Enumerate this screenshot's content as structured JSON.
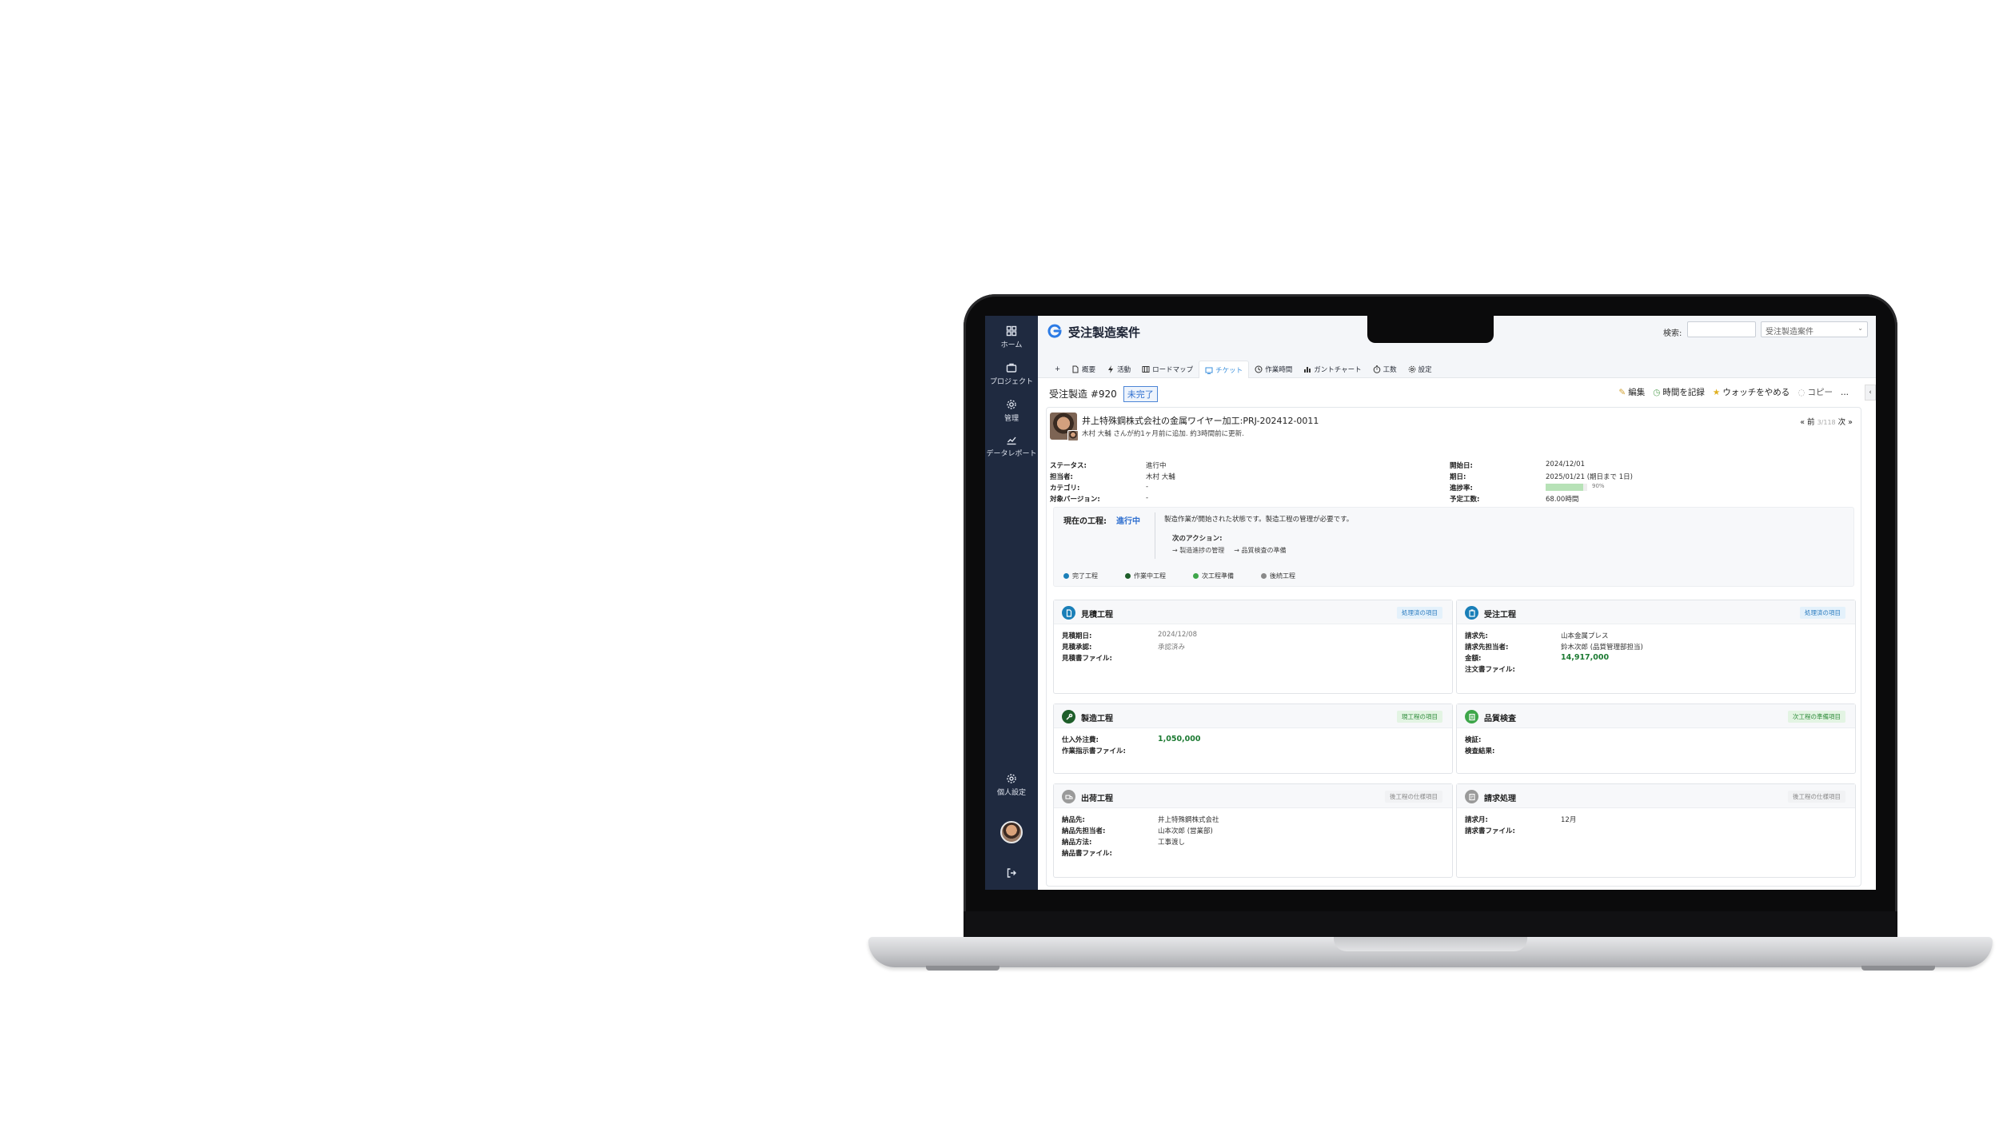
{
  "sidebar": {
    "items": [
      {
        "label": "ホーム",
        "icon": "dashboard-icon"
      },
      {
        "label": "プロジェクト",
        "icon": "briefcase-icon"
      },
      {
        "label": "管理",
        "icon": "gear-icon"
      },
      {
        "label": "データレポート",
        "icon": "chart-icon"
      }
    ],
    "personal": "個人設定"
  },
  "header": {
    "title": "受注製造案件",
    "search_label": "検索:",
    "search_value": "",
    "project_select": "受注製造案件"
  },
  "tabs": [
    {
      "label": "+",
      "icon": ""
    },
    {
      "label": "概要",
      "icon": "document-icon"
    },
    {
      "label": "活動",
      "icon": "bolt-icon"
    },
    {
      "label": "ロードマップ",
      "icon": "map-icon"
    },
    {
      "label": "チケット",
      "icon": "ticket-icon",
      "active": true
    },
    {
      "label": "作業時間",
      "icon": "clock-icon"
    },
    {
      "label": "ガントチャート",
      "icon": "bar-chart-icon"
    },
    {
      "label": "工数",
      "icon": "timer-icon"
    },
    {
      "label": "設定",
      "icon": "gear-icon"
    }
  ],
  "issue": {
    "heading": "受注製造 #920",
    "status_badge": "未完了",
    "actions": {
      "edit": "編集",
      "log_time": "時間を記録",
      "unwatch": "ウォッチをやめる",
      "copy": "コピー",
      "more": "..."
    },
    "subject": "井上特殊鋼株式会社の金属ワイヤー加工:PRJ-202412-0011",
    "meta": "木村 大輔 さんが約1ヶ月前に追加. 約3時間前に更新.",
    "pager": {
      "prev": "« 前",
      "count": "3/118",
      "next": "次 »"
    },
    "attributes_left": [
      {
        "label": "ステータス:",
        "value": "進行中"
      },
      {
        "label": "担当者:",
        "value": "木村 大輔"
      },
      {
        "label": "カテゴリ:",
        "value": "-"
      },
      {
        "label": "対象バージョン:",
        "value": "-"
      }
    ],
    "attributes_right": {
      "start_label": "開始日:",
      "start": "2024/12/01",
      "due_label": "期日:",
      "due": "2025/01/21 (期日まで 1日)",
      "progress_label": "進捗率:",
      "progress": 90,
      "progress_text": "90%",
      "estimate_label": "予定工数:",
      "estimate": "68.00時間"
    },
    "workflow": {
      "label": "現在の工程:",
      "state": "進行中",
      "description": "製造作業が開始された状態です。製造工程の管理が必要です。",
      "next_label": "次のアクション:",
      "next_actions": [
        "→ 製造進捗の管理",
        "→ 品質検査の準備"
      ],
      "legend": [
        {
          "label": "完了工程",
          "color": "#1a7fb8"
        },
        {
          "label": "作業中工程",
          "color": "#1e5e2a"
        },
        {
          "label": "次工程準備",
          "color": "#3ea64a"
        },
        {
          "label": "後続工程",
          "color": "#8a8a8a"
        }
      ]
    },
    "cards": [
      {
        "title": "見積工程",
        "badge": "処理済の項目",
        "fields": [
          {
            "k": "見積期日:",
            "v": "2024/12/08"
          },
          {
            "k": "見積承認:",
            "v": "承認済み"
          },
          {
            "k": "見積書ファイル:",
            "v": ""
          }
        ]
      },
      {
        "title": "受注工程",
        "badge": "処理済の項目",
        "fields": [
          {
            "k": "請求先:",
            "v": "山本金属プレス"
          },
          {
            "k": "請求先担当者:",
            "v": "鈴木次郎 (品質管理部担当)"
          },
          {
            "k": "金額:",
            "v": "14,917,000"
          },
          {
            "k": "注文書ファイル:",
            "v": ""
          }
        ]
      },
      {
        "title": "製造工程",
        "badge": "現工程の項目",
        "fields": [
          {
            "k": "仕入外注費:",
            "v": "1,050,000"
          },
          {
            "k": "作業指示書ファイル:",
            "v": ""
          }
        ]
      },
      {
        "title": "品質検査",
        "badge": "次工程の準備項目",
        "fields": [
          {
            "k": "検証:",
            "v": ""
          },
          {
            "k": "検査結果:",
            "v": ""
          }
        ]
      },
      {
        "title": "出荷工程",
        "badge": "後工程の仕様項目",
        "fields": [
          {
            "k": "納品先:",
            "v": "井上特殊鋼株式会社"
          },
          {
            "k": "納品先担当者:",
            "v": "山本次郎 (営業部)"
          },
          {
            "k": "納品方法:",
            "v": "工事渡し"
          },
          {
            "k": "納品書ファイル:",
            "v": ""
          }
        ]
      },
      {
        "title": "請求処理",
        "badge": "後工程の仕様項目",
        "fields": [
          {
            "k": "請求月:",
            "v": "12月"
          },
          {
            "k": "請求書ファイル:",
            "v": ""
          }
        ]
      }
    ]
  }
}
